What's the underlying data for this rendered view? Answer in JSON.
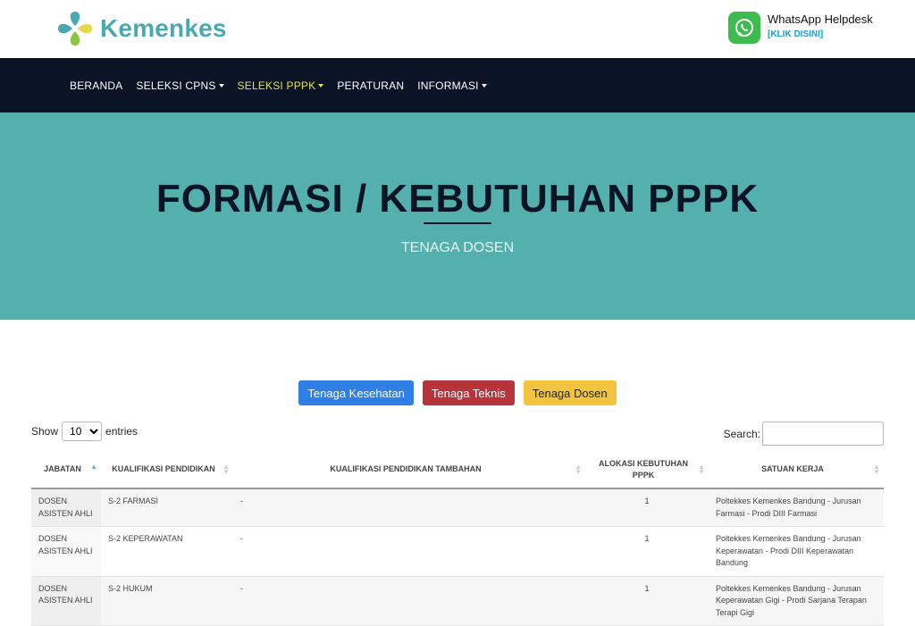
{
  "brand": {
    "name": "Kemenkes"
  },
  "helpdesk": {
    "title": "WhatsApp Helpdesk",
    "link": "[KLIK DISINI]"
  },
  "nav": {
    "items": [
      {
        "label": "BERANDA",
        "dropdown": false
      },
      {
        "label": "SELEKSI CPNS",
        "dropdown": true
      },
      {
        "label": "SELEKSI PPPK",
        "dropdown": true,
        "active": true
      },
      {
        "label": "PERATURAN",
        "dropdown": false
      },
      {
        "label": "INFORMASI",
        "dropdown": true
      }
    ]
  },
  "hero": {
    "title": "FORMASI / KEBUTUHAN PPPK",
    "subtitle": "TENAGA DOSEN"
  },
  "filters": {
    "kesehatan": "Tenaga Kesehatan",
    "teknis": "Tenaga Teknis",
    "dosen": "Tenaga Dosen"
  },
  "table_controls": {
    "show_label": "Show",
    "entries_value": "10",
    "entries_label": "entries",
    "search_label": "Search:"
  },
  "table": {
    "headers": [
      "JABATAN",
      "KUALIFIKASI PENDIDIKAN",
      "KUALIFIKASI PENDIDIKAN TAMBAHAN",
      "ALOKASI KEBUTUHAN PPPK",
      "SATUAN KERJA"
    ],
    "rows": [
      [
        "DOSEN ASISTEN AHLI",
        "S-2 FARMASI",
        "-",
        "1",
        "Poltekkes Kemenkes Bandung - Jurusan Farmasi - Prodi DIII Farmasi"
      ],
      [
        "DOSEN ASISTEN AHLI",
        "S-2 KEPERAWATAN",
        "-",
        "1",
        "Poltekkes Kemenkes Bandung - Jurusan Keperawatan - Prodi DIII Keperawatan Bandung"
      ],
      [
        "DOSEN ASISTEN AHLI",
        "S-2 HUKUM",
        "-",
        "1",
        "Poltekkes Kemenkes Bandung - Jurusan Keperawatan Gigi - Prodi Sarjana Terapan Terapi Gigi"
      ]
    ]
  },
  "colors": {
    "nav_bg": "#0b1426",
    "hero_bg": "#53b0ac",
    "active_nav": "#e5df4b",
    "brand": "#4aa9b0"
  }
}
